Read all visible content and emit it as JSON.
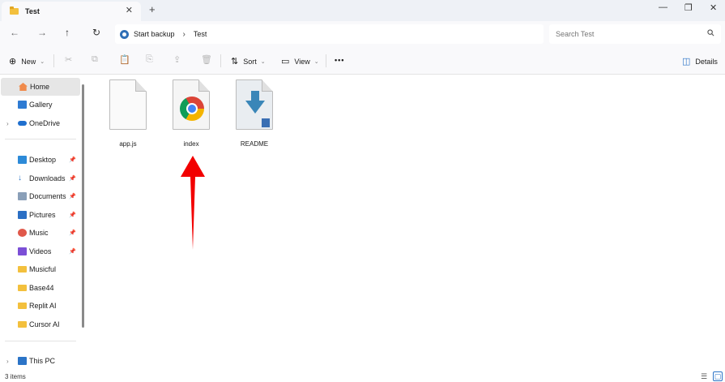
{
  "tab": {
    "title": "Test",
    "close": "✕",
    "new": "+"
  },
  "window": {
    "minimize": "—",
    "restore": "❐",
    "close": "✕"
  },
  "nav": {
    "back": "←",
    "forward": "→",
    "up": "↑",
    "refresh": "↻"
  },
  "address": {
    "crumbs": [
      "Start backup",
      "Test"
    ],
    "separator": "›"
  },
  "search": {
    "placeholder": "Search Test"
  },
  "commands": {
    "new_label": "New",
    "sort_label": "Sort",
    "view_label": "View",
    "more": "•••",
    "details_label": "Details"
  },
  "sidebar": {
    "home": "Home",
    "gallery": "Gallery",
    "onedrive": "OneDrive",
    "quick": [
      "Desktop",
      "Downloads",
      "Documents",
      "Pictures",
      "Music",
      "Videos",
      "Musicful",
      "Base44",
      "Replit AI",
      "Cursor AI"
    ],
    "thispc": "This PC"
  },
  "files": [
    {
      "name": "app.js",
      "icon": "blank-document-icon"
    },
    {
      "name": "index",
      "icon": "chrome-icon"
    },
    {
      "name": "README",
      "icon": "download-document-icon"
    }
  ],
  "status": {
    "count": "3 items"
  },
  "colors": {
    "accent": "#2b74c7",
    "arrow": "#f20000",
    "folder": "#f3c03d"
  }
}
